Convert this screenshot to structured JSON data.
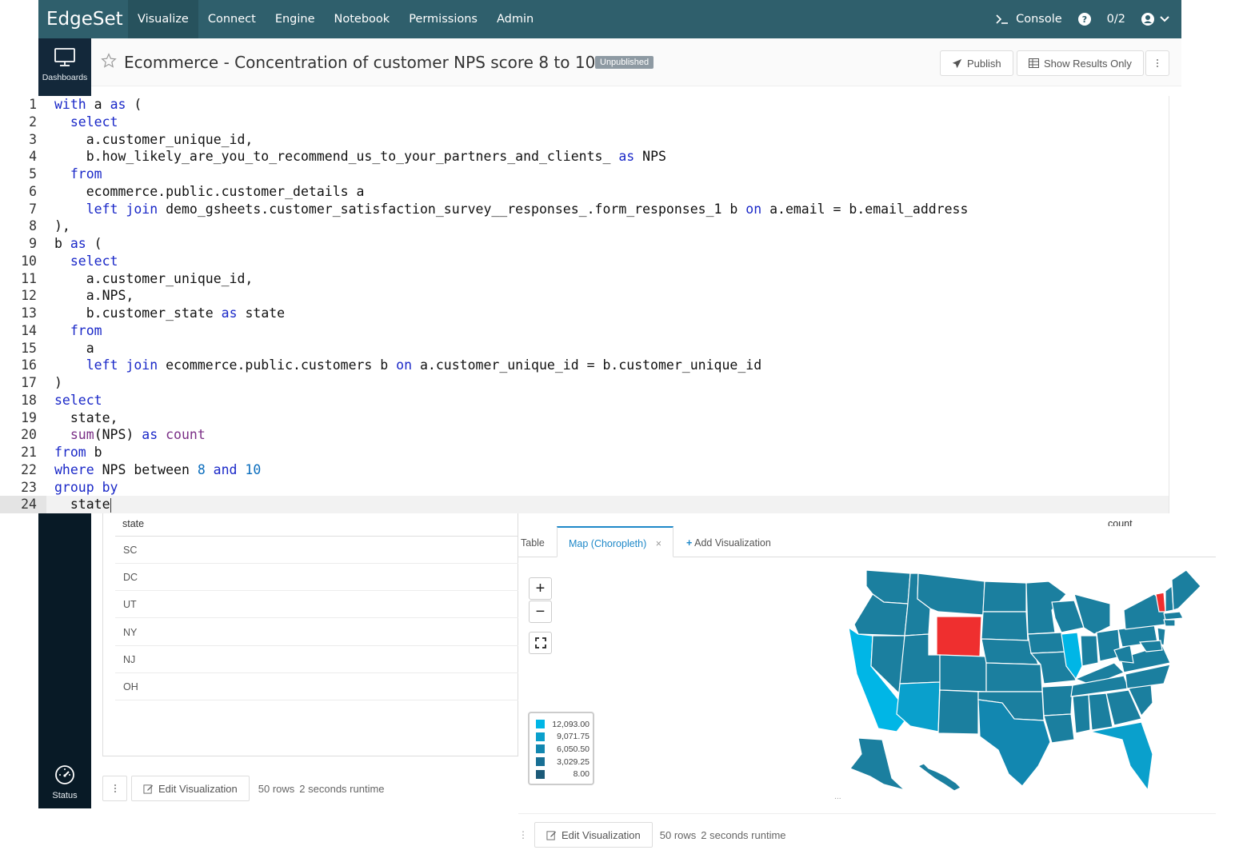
{
  "nav": {
    "brand": "EdgeSet",
    "items": [
      "Visualize",
      "Connect",
      "Engine",
      "Notebook",
      "Permissions",
      "Admin"
    ],
    "console_label": "Console",
    "counter": "0/2"
  },
  "sidebar": {
    "dashboards_label": "Dashboards",
    "status_label": "Status"
  },
  "header": {
    "title": "Ecommerce - Concentration of customer NPS score 8 to 10",
    "badge": "Unpublished",
    "publish_label": "Publish",
    "show_results_label": "Show Results Only"
  },
  "editor": {
    "current_line": 24,
    "lines": [
      "1",
      "2",
      "3",
      "4",
      "5",
      "6",
      "7",
      "8",
      "9",
      "10",
      "11",
      "12",
      "13",
      "14",
      "15",
      "16",
      "17",
      "18",
      "19",
      "20",
      "21",
      "22",
      "23",
      "24"
    ],
    "code": {
      "l1a": "with",
      "l1b": " a ",
      "l1c": "as",
      "l1d": " (",
      "l2": "select",
      "l3": "a.customer_unique_id,",
      "l4a": "b.how_likely_are_you_to_recommend_us_to_your_partners_and_clients_ ",
      "l4b": "as",
      "l4c": " NPS",
      "l5": "from",
      "l6": "ecommerce.public.customer_details a",
      "l7a": "left join",
      "l7b": " demo_gsheets.customer_satisfaction_survey__responses_.form_responses_1 b ",
      "l7c": "on",
      "l7d": " a.email = b.email_address",
      "l8": "),",
      "l9a": "b ",
      "l9b": "as",
      "l9c": " (",
      "l10": "select",
      "l11": "a.customer_unique_id,",
      "l12": "a.NPS,",
      "l13a": "b.customer_state ",
      "l13b": "as",
      "l13c": " state",
      "l14": "from",
      "l15": "a",
      "l16a": "left join",
      "l16b": " ecommerce.public.customers b ",
      "l16c": "on",
      "l16d": " a.customer_unique_id = b.customer_unique_id",
      "l17": ")",
      "l18": "select",
      "l19": "state,",
      "l20a": "sum",
      "l20b": "(NPS) ",
      "l20c": "as",
      "l20d": " count",
      "l21a": "from",
      "l21b": " b",
      "l22a": "where",
      "l22b": " NPS between ",
      "l22c": "8",
      "l22d": " and ",
      "l22e": "10",
      "l23": "group by",
      "l24": "state"
    }
  },
  "results": {
    "columns": [
      "state",
      "count"
    ],
    "rows": [
      "SC",
      "DC",
      "UT",
      "NY",
      "NJ",
      "OH"
    ],
    "summary_rows": "50 rows",
    "summary_runtime": "2 seconds runtime",
    "edit_label": "Edit Visualization"
  },
  "viz": {
    "tabs": [
      "Table",
      "Map (Choropleth)"
    ],
    "active_tab": "Map (Choropleth)",
    "add_label": "Add Visualization",
    "close_glyph": "×",
    "legend": [
      {
        "value": "12,093.00",
        "color": "#00b6e6"
      },
      {
        "value": "9,071.75",
        "color": "#0aa0cc"
      },
      {
        "value": "6,050.50",
        "color": "#1287b0"
      },
      {
        "value": "3,029.25",
        "color": "#186f94"
      },
      {
        "value": "8.00",
        "color": "#1c5a78"
      }
    ],
    "colors": {
      "base": "#1b7f9f",
      "highlight": "#00b6e6",
      "max": "#ef2f2f"
    },
    "summary_rows": "50 rows",
    "summary_runtime": "2 seconds runtime",
    "edit_label": "Edit Visualization",
    "attribution": "..."
  }
}
